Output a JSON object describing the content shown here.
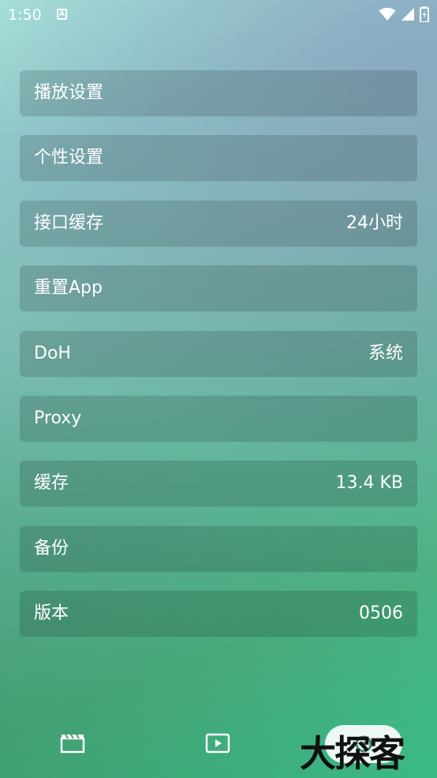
{
  "status": {
    "time": "1:50"
  },
  "settings": [
    {
      "label": "播放设置",
      "value": ""
    },
    {
      "label": "个性设置",
      "value": ""
    },
    {
      "label": "接口缓存",
      "value": "24小时"
    },
    {
      "label": "重置App",
      "value": ""
    },
    {
      "label": "DoH",
      "value": "系统"
    },
    {
      "label": "Proxy",
      "value": ""
    },
    {
      "label": "缓存",
      "value": "13.4 KB"
    },
    {
      "label": "备份",
      "value": ""
    },
    {
      "label": "版本",
      "value": "0506"
    }
  ],
  "nav": {
    "items": [
      "clapperboard-icon",
      "play-icon",
      "settings-tab"
    ],
    "active": "settings-tab"
  },
  "watermark": "大探客"
}
